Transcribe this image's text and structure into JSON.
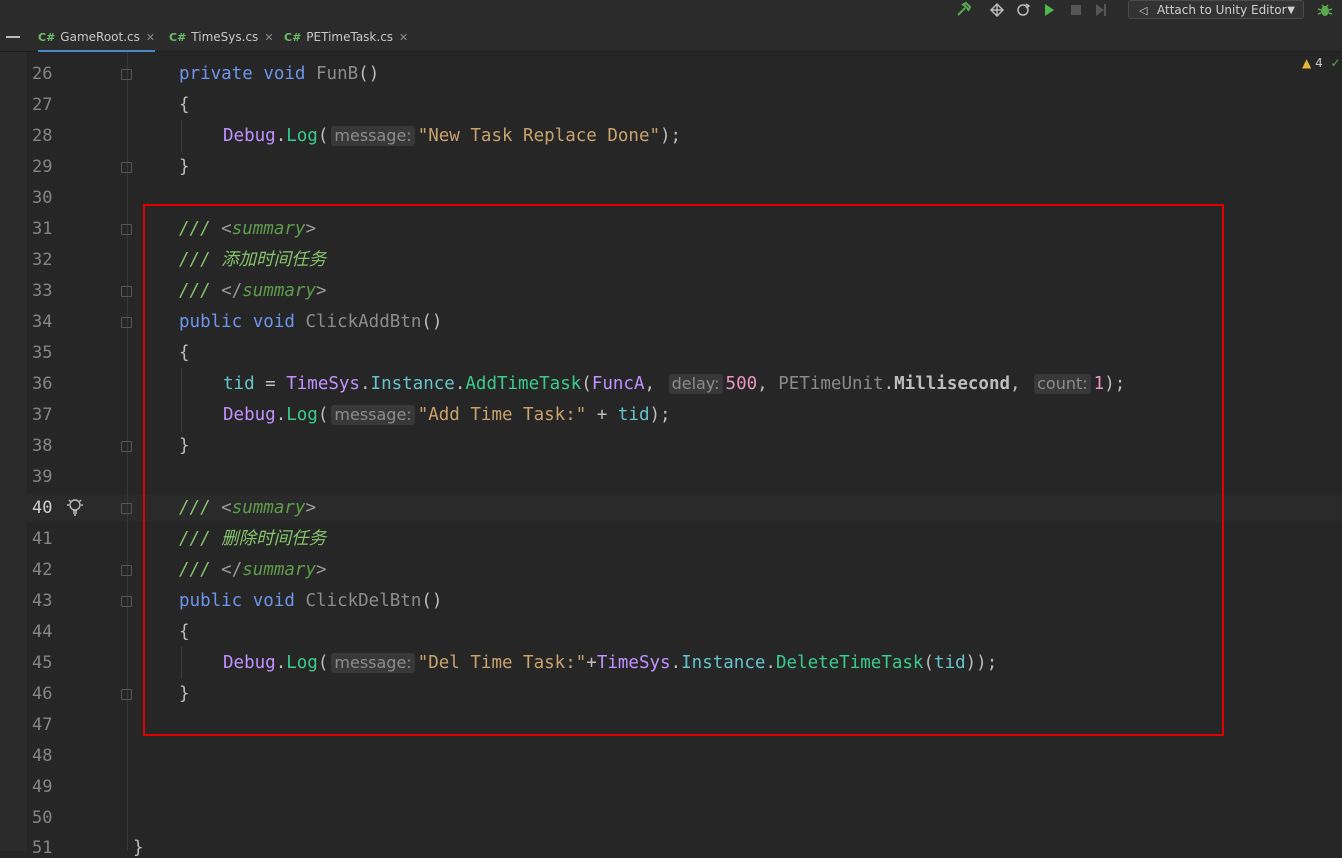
{
  "toolbar": {
    "build_icon": "hammer-icon",
    "unity_icon": "unity-icon",
    "refresh_icon": "refresh-icon",
    "run_icon": "play-icon",
    "stop_icon": "stop-icon",
    "step_icon": "step-icon",
    "attach_label": "Attach to Unity Editor",
    "debug_icon": "bug-icon"
  },
  "tabs": [
    {
      "lang": "C#",
      "label": "GameRoot.cs",
      "active": true
    },
    {
      "lang": "C#",
      "label": "TimeSys.cs",
      "active": false
    },
    {
      "lang": "C#",
      "label": "PETimeTask.cs",
      "active": false
    }
  ],
  "inspection": {
    "warnings": "4"
  },
  "line_numbers": [
    "26",
    "27",
    "28",
    "29",
    "30",
    "31",
    "32",
    "33",
    "34",
    "35",
    "36",
    "37",
    "38",
    "39",
    "40",
    "41",
    "42",
    "43",
    "44",
    "45",
    "46",
    "47",
    "48",
    "49",
    "50",
    "51"
  ],
  "code": {
    "funb": {
      "kw1": "private",
      "kw2": "void",
      "name": "FunB",
      "paren": "()"
    },
    "brace_open": "{",
    "brace_close": "}",
    "debug1": {
      "type": "Debug",
      "method": "Log",
      "hint": "message:",
      "str": "\"New Task Replace Done\"",
      "tail": ");"
    },
    "summary_open": "/// <summary>",
    "summary_close": "/// </summary>",
    "c_add": "/// 添加时间任务",
    "c_del": "/// 删除时间任务",
    "add": {
      "kw1": "public",
      "kw2": "void",
      "name": "ClickAddBtn",
      "paren": "()"
    },
    "add_line": {
      "var": "tid",
      "eq": " = ",
      "cls": "TimeSys",
      "prop": "Instance",
      "method": "AddTimeTask",
      "arg1": "FuncA",
      "hint_delay": "delay:",
      "delay": "500",
      "unit_cls": "PETimeUnit",
      "unit": "Millisecond",
      "hint_count": "count:",
      "count": "1",
      "tail": ");"
    },
    "debug2": {
      "type": "Debug",
      "method": "Log",
      "hint": "message:",
      "str": "\"Add Time Task:\"",
      "plus": " + ",
      "var": "tid",
      "tail": ");"
    },
    "del": {
      "kw1": "public",
      "kw2": "void",
      "name": "ClickDelBtn",
      "paren": "()"
    },
    "debug3": {
      "type": "Debug",
      "method": "Log",
      "hint": "message:",
      "str": "\"Del Time Task:\"",
      "plus": "+",
      "cls": "TimeSys",
      "prop": "Instance",
      "method2": "DeleteTimeTask",
      "var": "tid",
      "tail": "));"
    },
    "end_brace": "}"
  }
}
